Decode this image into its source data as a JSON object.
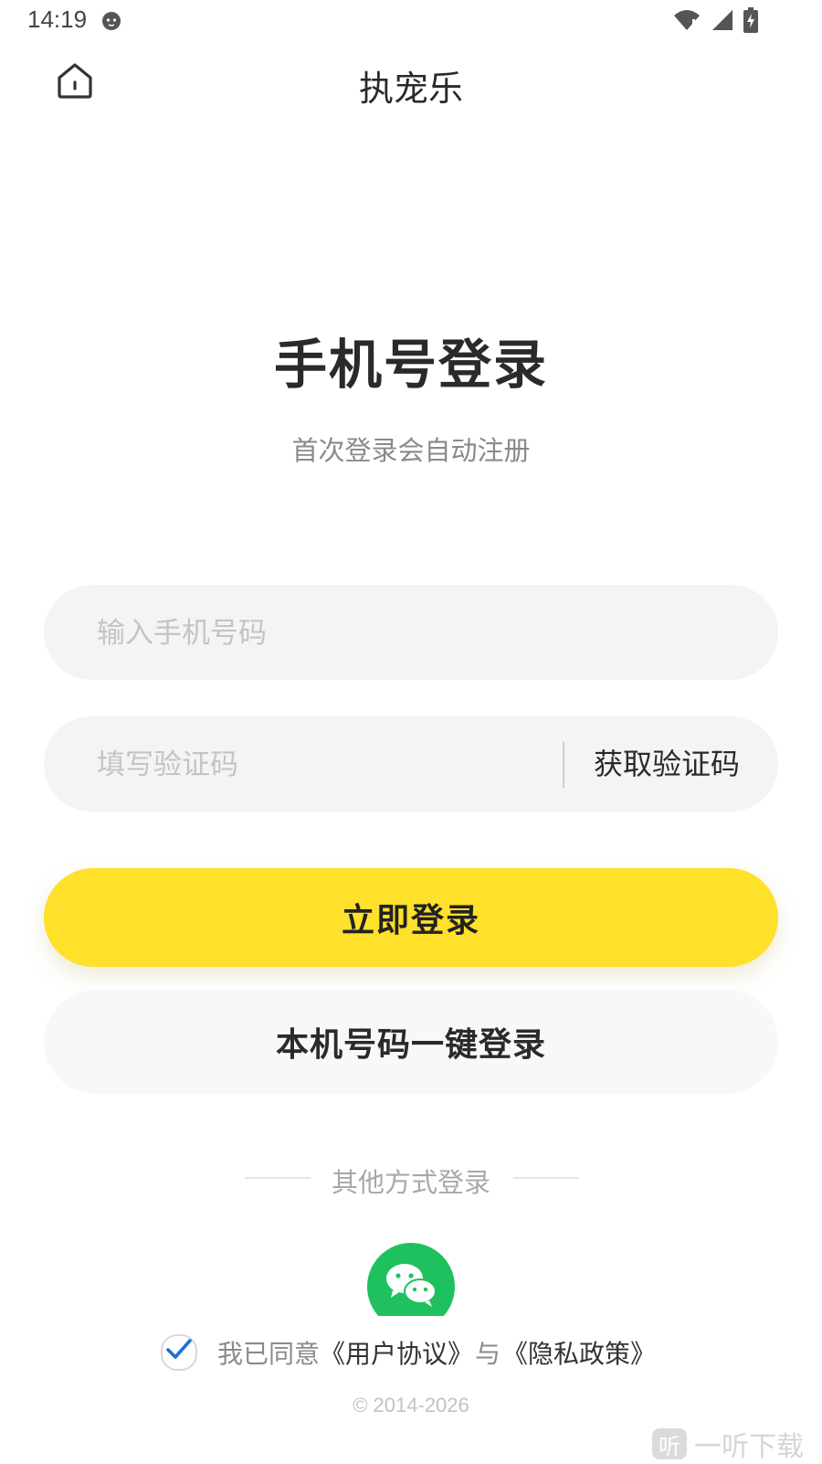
{
  "status_bar": {
    "time": "14:19"
  },
  "header": {
    "title": "执宠乐",
    "home_icon": "home-icon"
  },
  "login": {
    "heading": "手机号登录",
    "subtitle": "首次登录会自动注册",
    "phone_placeholder": "输入手机号码",
    "code_placeholder": "填写验证码",
    "get_code_label": "获取验证码",
    "submit_label": "立即登录",
    "one_click_label": "本机号码一键登录"
  },
  "other_methods": {
    "label": "其他方式登录",
    "wechat_icon": "wechat-icon"
  },
  "agreement": {
    "prefix": "我已同意",
    "user_agreement": "《用户协议》",
    "and": "与",
    "privacy_policy": "《隐私政策》",
    "checked": true
  },
  "footer": {
    "copyright": "© 2014-2026"
  },
  "watermark": {
    "logo_char": "听",
    "text": "一听下载"
  },
  "colors": {
    "primary": "#ffe02a",
    "wechat": "#1fc15e",
    "check": "#1e6fd9"
  }
}
